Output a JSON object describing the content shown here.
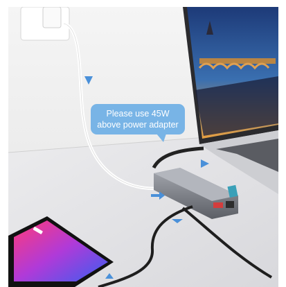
{
  "callout": {
    "line1": "Please use 45W",
    "line2": "above power adapter"
  },
  "colors": {
    "callout_bg": "#78b4e6",
    "arrow": "#4a90d9",
    "wall": "#f2f2f2",
    "desk": "#e4e4e6",
    "hub": "#7c7f86",
    "cable": "#222222"
  },
  "icons": [
    "wall-outlet-icon",
    "flow-arrow-icon"
  ]
}
